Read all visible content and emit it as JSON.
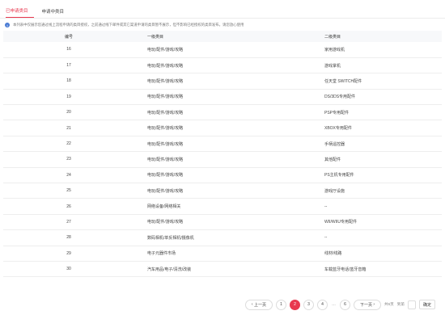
{
  "tabs": [
    {
      "label": "已申请类目"
    },
    {
      "label": "申请中类目"
    }
  ],
  "notice": {
    "icon": "info-icon",
    "text": "本列表中仅展示您通过线上流程申请的类目授权，之前通过线下邮件或其它渠道申请的类目暂不展示，但不影响已经授权的类目发布。请您放心使用"
  },
  "table": {
    "headers": {
      "no": "编号",
      "level1": "一级类目",
      "level2": "二级类目"
    },
    "rows": [
      {
        "no": "16",
        "level1": "电玩/配件/游戏/攻略",
        "level2": "家用游戏机"
      },
      {
        "no": "17",
        "level1": "电玩/配件/游戏/攻略",
        "level2": "游戏掌机"
      },
      {
        "no": "18",
        "level1": "电玩/配件/游戏/攻略",
        "level2": "任天堂 SWITCH配件"
      },
      {
        "no": "19",
        "level1": "电玩/配件/游戏/攻略",
        "level2": "DS/3DS专用配件"
      },
      {
        "no": "20",
        "level1": "电玩/配件/游戏/攻略",
        "level2": "PSP专用配件"
      },
      {
        "no": "21",
        "level1": "电玩/配件/游戏/攻略",
        "level2": "XBOX专用配件"
      },
      {
        "no": "22",
        "level1": "电玩/配件/游戏/攻略",
        "level2": "手柄遥控器"
      },
      {
        "no": "23",
        "level1": "电玩/配件/游戏/攻略",
        "level2": "其他配件"
      },
      {
        "no": "24",
        "level1": "电玩/配件/游戏/攻略",
        "level2": "PS主机专用配件"
      },
      {
        "no": "25",
        "level1": "电玩/配件/游戏/攻略",
        "level2": "游戏厅设施"
      },
      {
        "no": "26",
        "level1": "网络设备/网络相关",
        "level2": "--"
      },
      {
        "no": "27",
        "level1": "电玩/配件/游戏/攻略",
        "level2": "WII/WIIU专用配件"
      },
      {
        "no": "28",
        "level1": "数码相机/单反相机/摄像机",
        "level2": "--"
      },
      {
        "no": "29",
        "level1": "电子元器件市场",
        "level2": "线材/线路"
      },
      {
        "no": "30",
        "level1": "汽车用品/电子/清洗/改装",
        "level2": "车载蓝牙电话/蓝牙音箱"
      }
    ]
  },
  "pagination": {
    "prev_label": "上一页",
    "next_label": "下一页",
    "pages": [
      "1",
      "2",
      "3",
      "4"
    ],
    "ellipsis": "…",
    "last_page": "6",
    "active_page": "2",
    "goto_prefix": "共6页",
    "goto_text": "到第",
    "confirm_label": "确定"
  }
}
